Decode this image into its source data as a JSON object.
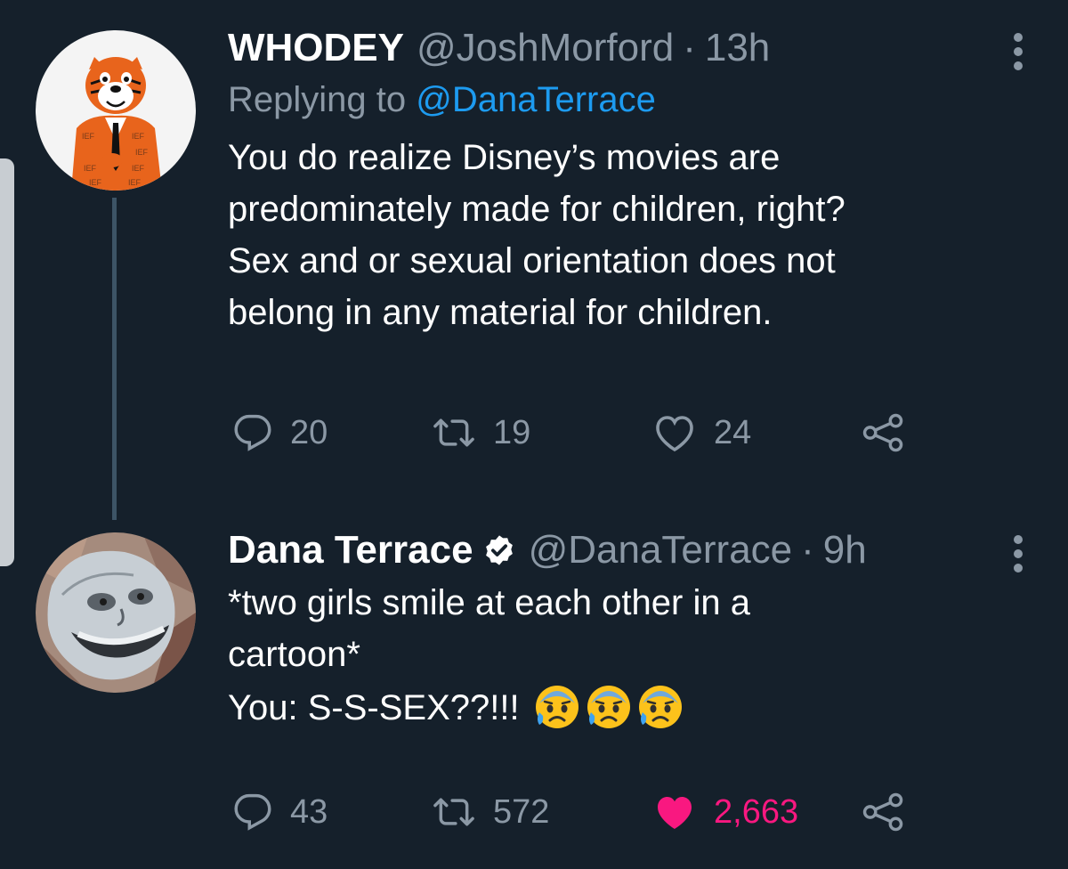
{
  "colors": {
    "background": "#15202b",
    "text_primary": "#ffffff",
    "text_secondary": "#8b98a5",
    "link": "#1d9bf0",
    "like_active": "#f91880",
    "thread_line": "#3d5466"
  },
  "tweets": [
    {
      "display_name": "WHODEY",
      "handle": "@JoshMorford",
      "separator": "·",
      "time": "13h",
      "replying_prefix": "Replying to",
      "replying_to": "@DanaTerrace",
      "verified": false,
      "lines": [
        "You do realize Disney’s movies are",
        "predominately made for children, right?",
        "Sex and or sexual orientation does not",
        "belong in any material for children."
      ],
      "avatar_icon": "tiger-mascot-avatar",
      "replies": "20",
      "retweets": "19",
      "likes": "24",
      "liked": false
    },
    {
      "display_name": "Dana Terrace",
      "handle": "@DanaTerrace",
      "separator": "·",
      "time": "9h",
      "verified": true,
      "lines": [
        "*two girls smile at each other in a",
        "cartoon*",
        "You: S-S-SEX??!!!"
      ],
      "emojis": [
        "anxious-face-with-sweat",
        "anxious-face-with-sweat",
        "anxious-face-with-sweat"
      ],
      "avatar_icon": "medieval-art-face-avatar",
      "replies": "43",
      "retweets": "572",
      "likes": "2,663",
      "liked": true
    }
  ]
}
